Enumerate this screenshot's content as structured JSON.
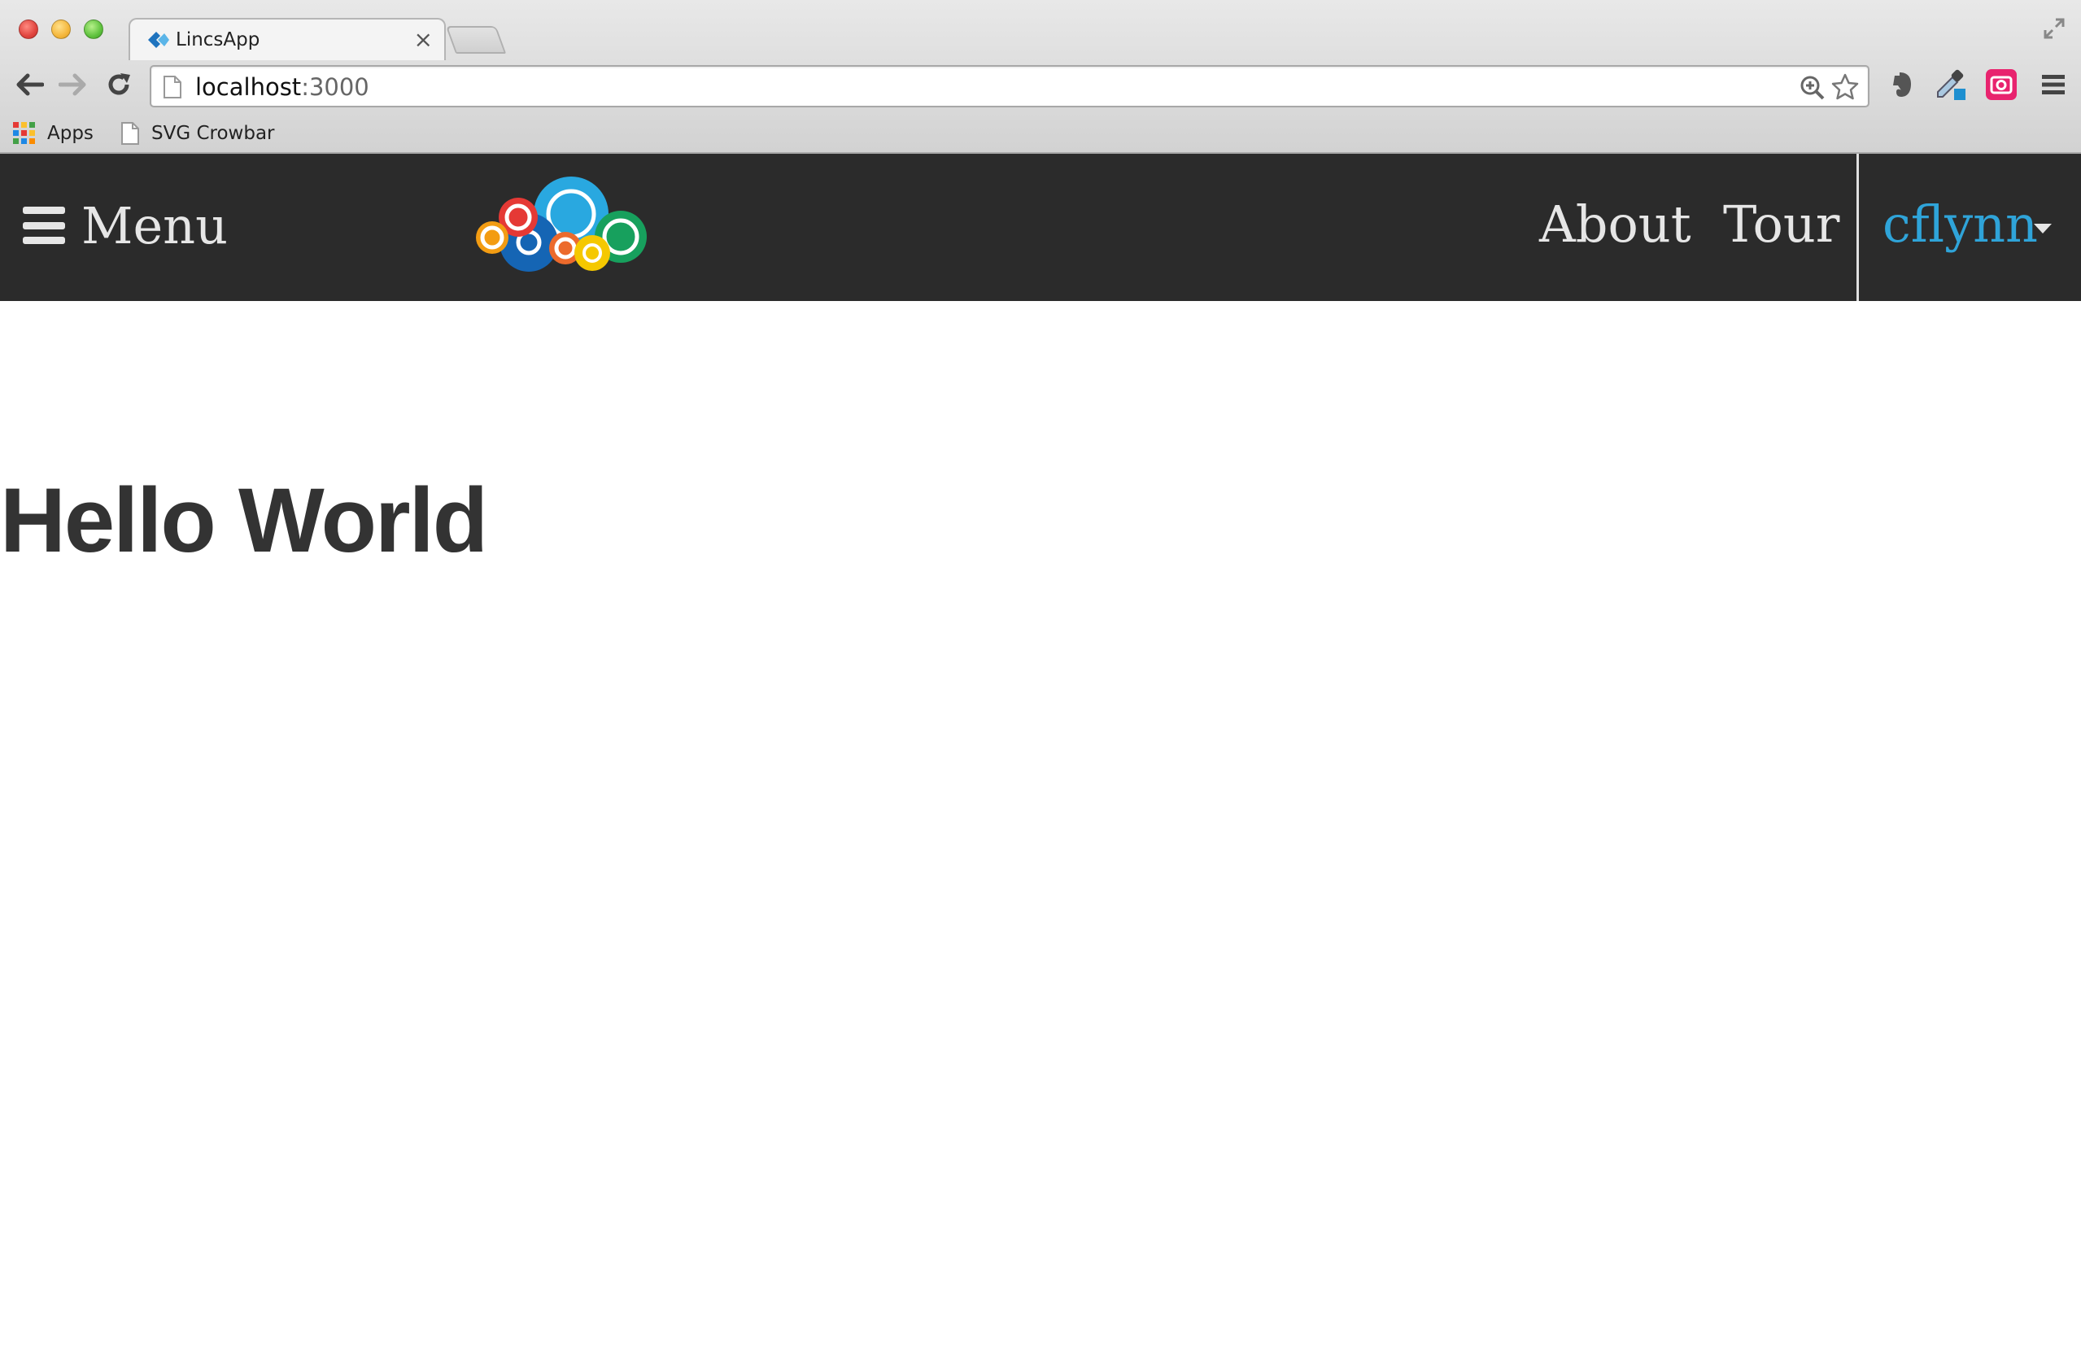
{
  "browser": {
    "tab": {
      "title": "LincsApp"
    },
    "url": {
      "host": "localhost",
      "port": ":3000"
    },
    "bookmarks": [
      {
        "label": "Apps"
      },
      {
        "label": "SVG Crowbar"
      }
    ]
  },
  "navbar": {
    "menu_label": "Menu",
    "links": [
      {
        "label": "About"
      },
      {
        "label": "Tour"
      }
    ],
    "user": "cflynn",
    "user_color": "#2fa4d9",
    "background": "#2b2b2b"
  },
  "main": {
    "heading": "Hello World"
  }
}
